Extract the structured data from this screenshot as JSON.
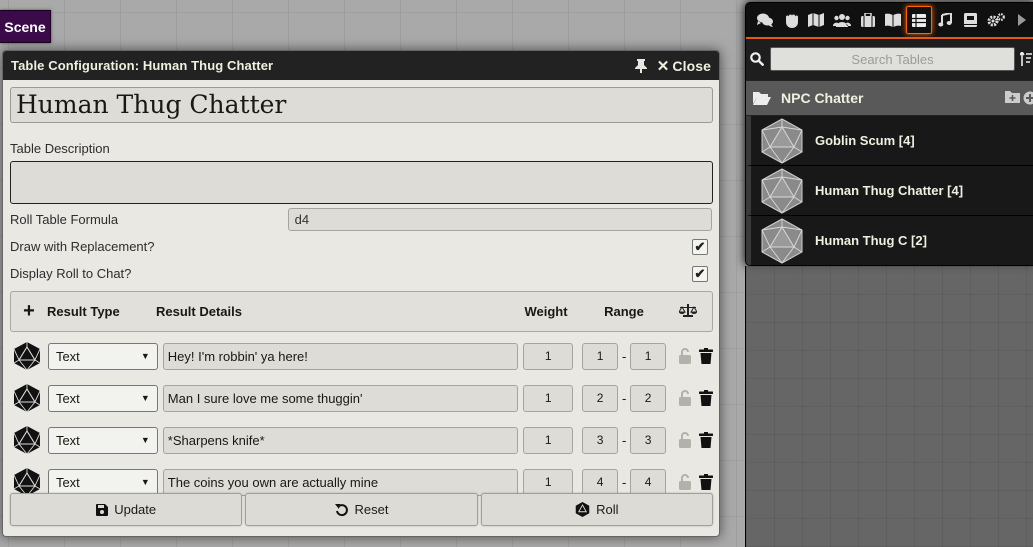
{
  "scene_button": "Scene",
  "dialog": {
    "title": "Table Configuration: Human Thug Chatter",
    "close_label": "Close",
    "name_value": "Human Thug Chatter",
    "description_label": "Table Description",
    "description_value": "",
    "formula_label": "Roll Table Formula",
    "formula_value": "d4",
    "replacement_label": "Draw with Replacement?",
    "replacement_checked": true,
    "display_roll_label": "Display Roll to Chat?",
    "display_roll_checked": true,
    "columns": {
      "add": "+",
      "type": "Result Type",
      "details": "Result Details",
      "weight": "Weight",
      "range": "Range"
    },
    "results": [
      {
        "type": "Text",
        "details": "Hey! I'm robbin' ya here!",
        "weight": "1",
        "range_low": "1",
        "range_high": "1"
      },
      {
        "type": "Text",
        "details": "Man I sure love me some thuggin'",
        "weight": "1",
        "range_low": "2",
        "range_high": "2"
      },
      {
        "type": "Text",
        "details": "*Sharpens knife*",
        "weight": "1",
        "range_low": "3",
        "range_high": "3"
      },
      {
        "type": "Text",
        "details": "The coins you own are actually mine",
        "weight": "1",
        "range_low": "4",
        "range_high": "4"
      }
    ],
    "footer": {
      "update": "Update",
      "reset": "Reset",
      "roll": "Roll"
    }
  },
  "sidebar": {
    "tabs": [
      "chat-icon",
      "combat-fist-icon",
      "map-icon",
      "actors-icon",
      "items-icon",
      "journal-icon",
      "tables-icon",
      "playlist-icon",
      "compendium-icon",
      "settings-icon",
      "collapse-arrow-icon"
    ],
    "active_tab": "tables-icon",
    "search_placeholder": "Search Tables",
    "folder_name": "NPC Chatter",
    "entries": [
      {
        "name": "Goblin Scum [4]"
      },
      {
        "name": "Human Thug Chatter [4]"
      },
      {
        "name": "Human Thug C [2]"
      }
    ],
    "accent_color": "#ff6400"
  }
}
